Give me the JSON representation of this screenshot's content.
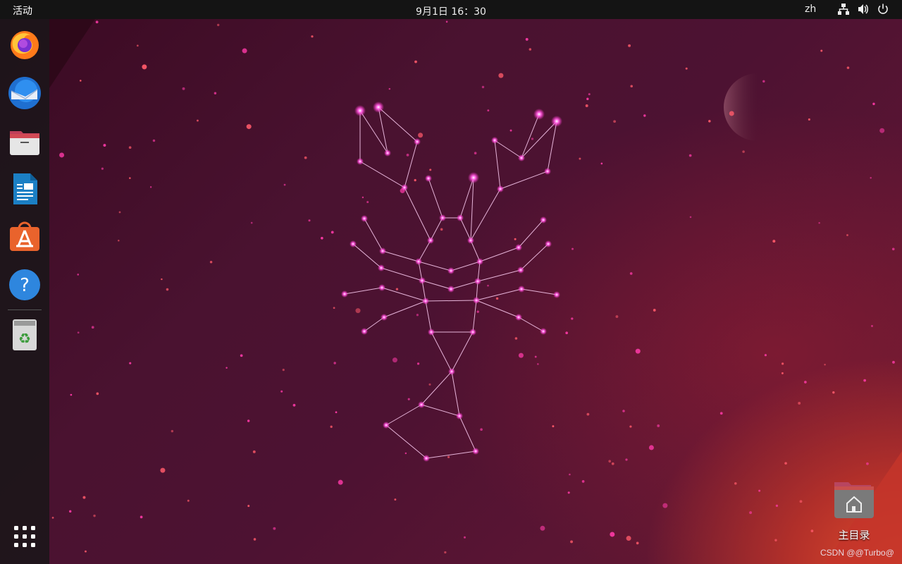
{
  "topbar": {
    "activities_label": "活动",
    "clock_text": "9月1日  16：30",
    "language": "zh",
    "tray_icons": [
      "network-icon",
      "volume-icon",
      "power-icon"
    ]
  },
  "dock": {
    "items": [
      {
        "name": "Firefox",
        "icon": "firefox-icon"
      },
      {
        "name": "Thunderbird",
        "icon": "thunderbird-icon"
      },
      {
        "name": "Files",
        "icon": "files-icon"
      },
      {
        "name": "LibreOffice Writer",
        "icon": "writer-icon"
      },
      {
        "name": "Ubuntu Software",
        "icon": "software-store-icon"
      },
      {
        "name": "Help",
        "icon": "help-icon"
      },
      {
        "name": "Trash",
        "icon": "trash-icon"
      }
    ],
    "show_apps_icon": "app-grid-icon"
  },
  "desktop": {
    "home_folder_label": "主目录"
  },
  "watermark": "CSDN @@Turbo@",
  "colors": {
    "topbar_bg": "#141414",
    "dock_bg": "#1c161a",
    "wallpaper_main": "#4a1230",
    "constellation": "#ff4fd8"
  }
}
